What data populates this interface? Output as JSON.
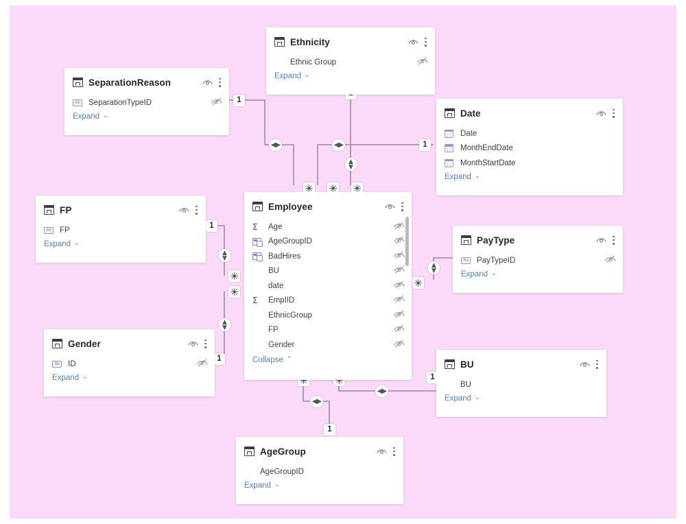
{
  "canvas": {
    "background": "#fbd9f8",
    "page_background": "#ffffff"
  },
  "theme": {
    "table_background": "#ffffff",
    "link_color": "#4b7fd4",
    "line_color": "#8d7f90",
    "text_color": "#3c3b45"
  },
  "labels": {
    "expand": "Expand",
    "collapse": "Collapse",
    "chevron_down": "⌄",
    "chevron_up": "⌃",
    "one": "1",
    "many": "✳",
    "both_horizontal": "◀▶",
    "both_vertical_top": "▲",
    "both_vertical_bottom": "▼"
  },
  "tables": [
    {
      "id": "ethnicity",
      "name": "Ethnicity",
      "toggle_label": "Expand",
      "fields": [
        {
          "name": "Ethnic Group",
          "icon": "none",
          "hidden": true
        }
      ]
    },
    {
      "id": "separationreason",
      "name": "SeparationReason",
      "toggle_label": "Expand",
      "fields": [
        {
          "name": "SeparationTypeID",
          "icon": "text-field-icon",
          "hidden": true
        }
      ]
    },
    {
      "id": "date",
      "name": "Date",
      "toggle_label": "Expand",
      "fields": [
        {
          "name": "Date",
          "icon": "calendar-icon",
          "hidden": false
        },
        {
          "name": "MonthEndDate",
          "icon": "calendar-icon",
          "hidden": false
        },
        {
          "name": "MonthStartDate",
          "icon": "calendar-icon",
          "hidden": false
        }
      ]
    },
    {
      "id": "fp",
      "name": "FP",
      "toggle_label": "Expand",
      "fields": [
        {
          "name": "FP",
          "icon": "text-field-icon",
          "hidden": false
        }
      ]
    },
    {
      "id": "employee",
      "name": "Employee",
      "toggle_label": "Collapse",
      "scrollbar": true,
      "fields": [
        {
          "name": "Age",
          "icon": "sigma-icon",
          "hidden": true
        },
        {
          "name": "AgeGroupID",
          "icon": "calculated-column-icon",
          "hidden": true
        },
        {
          "name": "BadHires",
          "icon": "calculated-column-icon",
          "hidden": true
        },
        {
          "name": "BU",
          "icon": "none",
          "hidden": true
        },
        {
          "name": "date",
          "icon": "none",
          "hidden": true
        },
        {
          "name": "EmpIID",
          "icon": "sigma-icon",
          "hidden": true
        },
        {
          "name": "EthnicGroup",
          "icon": "none",
          "hidden": true
        },
        {
          "name": "FP",
          "icon": "none",
          "hidden": true
        },
        {
          "name": "Gender",
          "icon": "none",
          "hidden": true
        }
      ]
    },
    {
      "id": "paytype",
      "name": "PayType",
      "toggle_label": "Expand",
      "fields": [
        {
          "name": "PayTypeID",
          "icon": "text-field-icon",
          "hidden": true
        }
      ]
    },
    {
      "id": "gender",
      "name": "Gender",
      "toggle_label": "Expand",
      "fields": [
        {
          "name": "ID",
          "icon": "text-field-icon",
          "hidden": true
        }
      ]
    },
    {
      "id": "bu",
      "name": "BU",
      "toggle_label": "Expand",
      "fields": [
        {
          "name": "BU",
          "icon": "none",
          "hidden": false
        }
      ]
    },
    {
      "id": "agegroup",
      "name": "AgeGroup",
      "toggle_label": "Expand",
      "fields": [
        {
          "name": "AgeGroupID",
          "icon": "none",
          "hidden": false
        }
      ]
    }
  ],
  "relationships": [
    {
      "from": "SeparationReason",
      "to": "Employee",
      "from_cardinality": "1",
      "to_cardinality": "✳",
      "cross_filter": "both-horizontal"
    },
    {
      "from": "Ethnicity",
      "to": "Employee",
      "from_cardinality": "1",
      "to_cardinality": "✳",
      "cross_filter": "both-horizontal"
    },
    {
      "from": "Date",
      "to": "Employee",
      "from_cardinality": "1",
      "to_cardinality": "✳",
      "cross_filter": "both-vertical"
    },
    {
      "from": "FP",
      "to": "Employee",
      "from_cardinality": "1",
      "to_cardinality": "✳",
      "cross_filter": "both-vertical"
    },
    {
      "from": "Gender",
      "to": "Employee",
      "from_cardinality": "1",
      "to_cardinality": "✳",
      "cross_filter": "both-vertical"
    },
    {
      "from": "PayType",
      "to": "Employee",
      "from_cardinality": "1",
      "to_cardinality": "✳",
      "cross_filter": "both-vertical"
    },
    {
      "from": "BU",
      "to": "Employee",
      "from_cardinality": "1",
      "to_cardinality": "✳",
      "cross_filter": "both-horizontal"
    },
    {
      "from": "AgeGroup",
      "to": "Employee",
      "from_cardinality": "1",
      "to_cardinality": "✳",
      "cross_filter": "both-horizontal"
    }
  ]
}
